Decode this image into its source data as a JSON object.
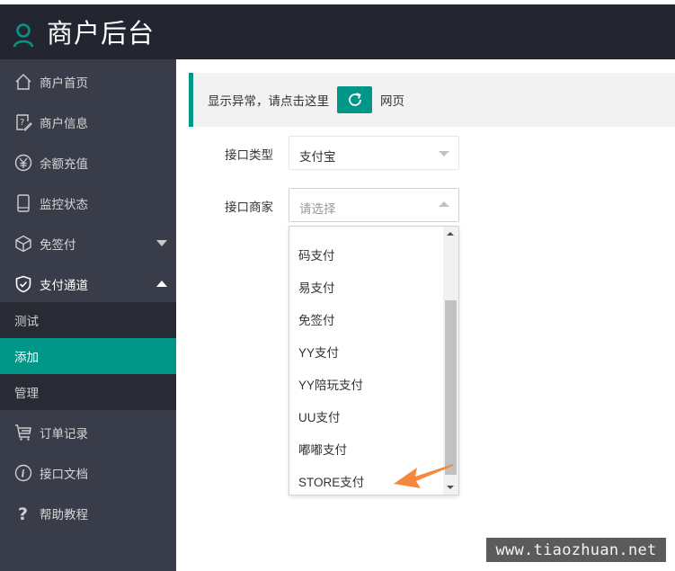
{
  "header": {
    "title": "商户后台",
    "logo_icon": "user-icon",
    "accent_color": "#009688"
  },
  "sidebar": {
    "items": [
      {
        "label": "商户首页",
        "icon": "home-icon"
      },
      {
        "label": "商户信息",
        "icon": "info-edit-icon"
      },
      {
        "label": "余额充值",
        "icon": "yen-icon"
      },
      {
        "label": "监控状态",
        "icon": "phone-icon"
      },
      {
        "label": "免签付",
        "icon": "cube-icon",
        "caret": "down"
      },
      {
        "label": "支付通道",
        "icon": "shield-check-icon",
        "caret": "up",
        "expanded": true
      },
      {
        "label": "订单记录",
        "icon": "cart-icon"
      },
      {
        "label": "接口文档",
        "icon": "info-circle-icon"
      },
      {
        "label": "帮助教程",
        "icon": "question-icon"
      }
    ],
    "subitems": [
      {
        "label": "测试",
        "active": false
      },
      {
        "label": "添加",
        "active": true
      },
      {
        "label": "管理",
        "active": false
      }
    ]
  },
  "alert": {
    "text_before": "显示异常，请点击这里",
    "refresh_icon": "refresh-icon",
    "text_after": "网页"
  },
  "form": {
    "type_label": "接口类型",
    "type_value": "支付宝",
    "merchant_label": "接口商家",
    "merchant_placeholder": "请选择",
    "merchant_options": [
      "码支付",
      "易支付",
      "免签付",
      "YY支付",
      "YY陪玩支付",
      "UU支付",
      "嘟嘟支付",
      "STORE支付"
    ]
  },
  "annotation": {
    "arrow_color": "#f5883a",
    "points_to": "STORE支付"
  },
  "watermark": "www.tiaozhuan.net"
}
